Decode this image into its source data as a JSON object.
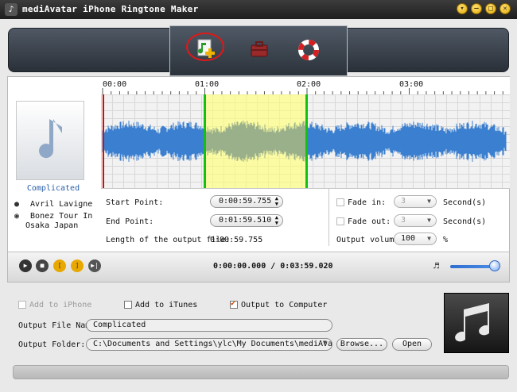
{
  "window": {
    "title": "mediAvatar iPhone Ringtone Maker",
    "controls": {
      "minimize_glyph": "–",
      "maximize_glyph": "□",
      "close_glyph": "✕",
      "menu_glyph": "▾"
    }
  },
  "toolbar": {
    "buttons": [
      {
        "icon": "add-file-icon"
      },
      {
        "icon": "toolbox-icon"
      },
      {
        "icon": "lifebuoy-icon"
      }
    ]
  },
  "song": {
    "title": "Complicated",
    "artist": "Avril Lavigne",
    "album_line1": "Bonez Tour In",
    "album_line2": "Osaka Japan"
  },
  "timeline": {
    "ticks": [
      "00:00",
      "01:00",
      "02:00",
      "03:00"
    ]
  },
  "waveform": {
    "color": "#3a7fd0",
    "selection_color": "#ffff80",
    "duration_seconds": 239.02,
    "selection_start_seconds": 59.755,
    "selection_end_seconds": 119.51,
    "playhead_seconds": 0
  },
  "settings": {
    "start_point_label": "Start Point:",
    "start_point_value": "0:00:59.755",
    "end_point_label": "End Point:",
    "end_point_value": "0:01:59.510",
    "length_label": "Length of the output file:",
    "length_value": "0:00:59.755",
    "fade_in_label": "Fade in:",
    "fade_in_value": "3",
    "fade_out_label": "Fade out:",
    "fade_out_value": "3",
    "seconds_unit": "Second(s)",
    "output_volume_label": "Output volume:",
    "output_volume_value": "100",
    "percent_unit": "%"
  },
  "player": {
    "time_readout": "0:00:00.000 / 0:03:59.020",
    "volume_level": 0.9
  },
  "output": {
    "add_to_iphone_label": "Add to iPhone",
    "add_to_itunes_label": "Add to iTunes",
    "output_to_computer_label": "Output to Computer",
    "file_name_label": "Output File Name:",
    "file_name_value": "Complicated",
    "folder_label": "Output Folder:",
    "folder_value": "C:\\Documents and Settings\\ylc\\My Documents\\mediAvatar\\iPhone",
    "browse_label": "Browse...",
    "open_label": "Open"
  }
}
